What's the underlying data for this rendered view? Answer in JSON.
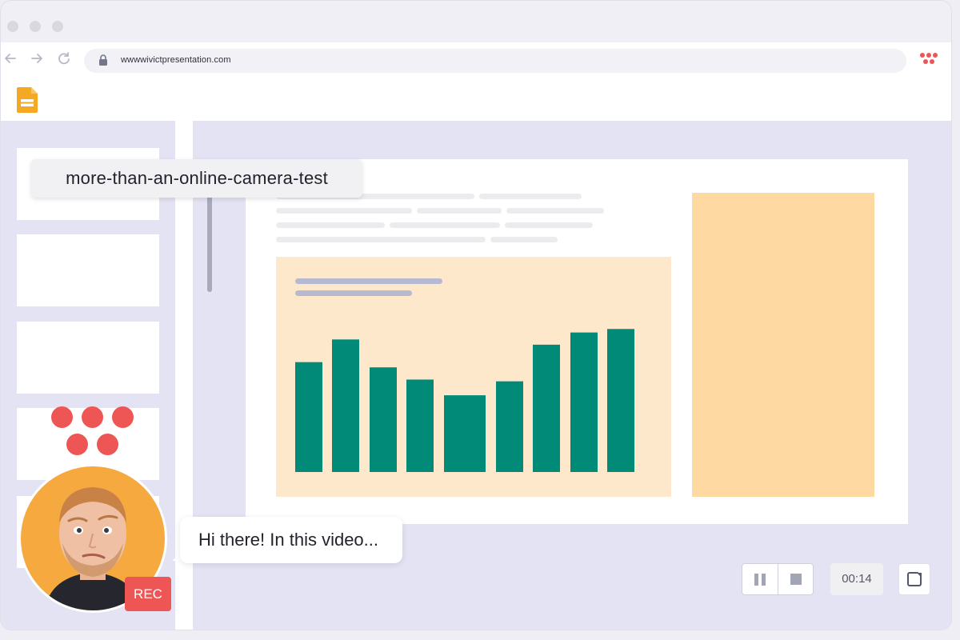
{
  "browser": {
    "url": "wwwwivictpresentation.com"
  },
  "slide_tooltip": {
    "text": "more-than-an-online-camera-test"
  },
  "recorder": {
    "rec_label": "REC",
    "speech_bubble": "Hi there! In this video...",
    "timer": "00:14"
  },
  "colors": {
    "brand_red": "#ee5555",
    "bar_teal": "#028a78",
    "chart_background": "#fde8cb",
    "side_panel": "#fed9a1"
  },
  "chart_data": {
    "type": "bar",
    "categories": [
      "",
      "",
      "",
      "",
      "",
      "",
      "",
      "",
      ""
    ],
    "values": [
      63,
      76,
      60,
      53,
      44,
      52,
      73,
      80,
      82
    ],
    "ylim": [
      0,
      100
    ],
    "title": "",
    "xlabel": "",
    "ylabel": "",
    "grid": false
  }
}
